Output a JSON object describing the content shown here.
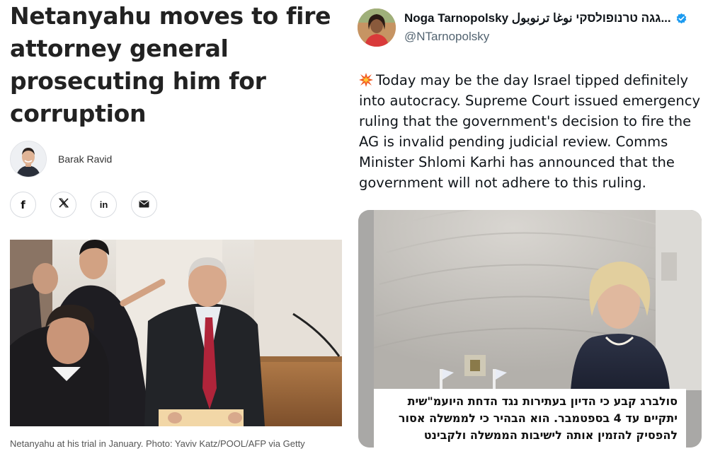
{
  "article": {
    "headline": "Netanyahu moves to fire attorney general prosecuting him for corruption",
    "author": "Barak Ravid",
    "share": [
      {
        "icon": "facebook-icon",
        "glyph": "f"
      },
      {
        "icon": "x-icon",
        "glyph": "𝕏"
      },
      {
        "icon": "linkedin-icon",
        "glyph": "in"
      },
      {
        "icon": "mail-icon",
        "glyph": "✉"
      }
    ],
    "caption": "Netanyahu at his trial in January. Photo: Yaviv Katz/POOL/AFP via Getty"
  },
  "tweet": {
    "display_name": "Noga Tarnopolsky גגה טרנופולסקי نوغا ترنوبول...",
    "handle": "@NTarnopolsky",
    "text": "Today may be the day Israel tipped definitely into autocracy. Supreme Court issued emergency ruling that the government's decision to fire the AG is invalid pending judicial review. Comms Minister Shlomi Karhi has announced that the government will not adhere to this ruling.",
    "text_icon": "collision-emoji-icon",
    "media_caption": [
      "סולברג קבע כי הדיון בעתירות נגד הדחת היועמ\"שית",
      "יתקיים עד 4 בספטמבר. הוא הבהיר כי לממשלה אסור",
      "להפסיק להזמין אותה לישיבות הממשלה ולקבינט"
    ]
  },
  "colors": {
    "verified": "#1d9bf0",
    "handle": "#536471",
    "text": "#0f1419",
    "tie": "#b0243a"
  }
}
